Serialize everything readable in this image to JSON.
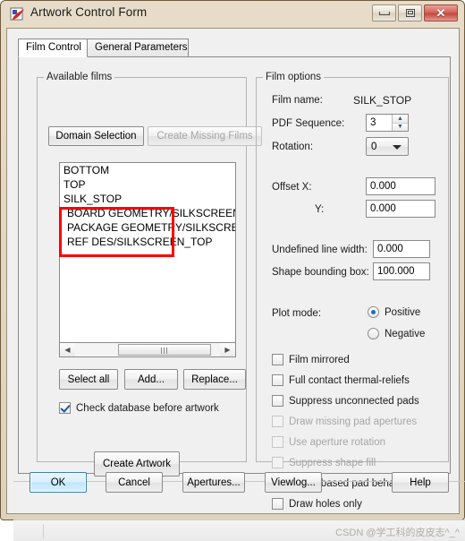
{
  "window": {
    "title": "Artwork Control Form",
    "icon": "artwork-app-icon",
    "controls": {
      "minimize": "minimize-icon",
      "maximize": "maximize-icon",
      "close": "close-icon"
    }
  },
  "tabs": [
    {
      "label": "Film Control",
      "active": true
    },
    {
      "label": "General Parameters",
      "active": false
    }
  ],
  "available_films": {
    "group_title": "Available films",
    "buttons": {
      "domain_selection": "Domain Selection",
      "create_missing_films": "Create Missing Films",
      "create_missing_films_disabled": true
    },
    "items": [
      {
        "label": "BOTTOM",
        "indent": false
      },
      {
        "label": "TOP",
        "indent": false
      },
      {
        "label": "SILK_STOP",
        "indent": false
      },
      {
        "label": "BOARD GEOMETRY/SILKSCREEN_TOP",
        "indent": true
      },
      {
        "label": "PACKAGE GEOMETRY/SILKSCREEN_TOP",
        "indent": true
      },
      {
        "label": "REF DES/SILKSCREEN_TOP",
        "indent": true
      }
    ],
    "list_buttons": [
      {
        "label": "Select all"
      },
      {
        "label": "Add..."
      },
      {
        "label": "Replace..."
      }
    ],
    "check_database": {
      "label": "Check database before artwork",
      "checked": true
    },
    "create_artwork": "Create Artwork"
  },
  "film_options": {
    "group_title": "Film options",
    "film_name_label": "Film name:",
    "film_name_value": "SILK_STOP",
    "pdf_sequence_label": "PDF Sequence:",
    "pdf_sequence_value": "3",
    "rotation_label": "Rotation:",
    "rotation_value": "0",
    "offset_x_label": "Offset  X:",
    "offset_x_value": "0.000",
    "offset_y_label": "Y:",
    "offset_y_value": "0.000",
    "undefined_line_width_label": "Undefined line width:",
    "undefined_line_width_value": "0.000",
    "shape_bounding_box_label": "Shape bounding box:",
    "shape_bounding_box_value": "100.000",
    "plot_mode_label": "Plot mode:",
    "plot_modes": [
      {
        "label": "Positive",
        "selected": true
      },
      {
        "label": "Negative",
        "selected": false
      }
    ],
    "checkboxes": [
      {
        "label": "Film mirrored",
        "checked": false,
        "disabled": false
      },
      {
        "label": "Full contact thermal-reliefs",
        "checked": false,
        "disabled": false
      },
      {
        "label": "Suppress unconnected pads",
        "checked": false,
        "disabled": false
      },
      {
        "label": "Draw missing pad apertures",
        "checked": false,
        "disabled": true
      },
      {
        "label": "Use aperture rotation",
        "checked": false,
        "disabled": true
      },
      {
        "label": "Suppress shape fill",
        "checked": false,
        "disabled": true
      },
      {
        "label": "Vector based pad behavior",
        "checked": true,
        "disabled": false
      },
      {
        "label": "Draw holes only",
        "checked": false,
        "disabled": false
      }
    ]
  },
  "footer_buttons": [
    {
      "label": "OK",
      "default": true
    },
    {
      "label": "Cancel",
      "default": false
    },
    {
      "label": "Apertures...",
      "default": false
    },
    {
      "label": "Viewlog...",
      "default": false
    },
    {
      "label": "Help",
      "default": false
    }
  ],
  "watermark": "CSDN @学工科的皮皮志^_^"
}
